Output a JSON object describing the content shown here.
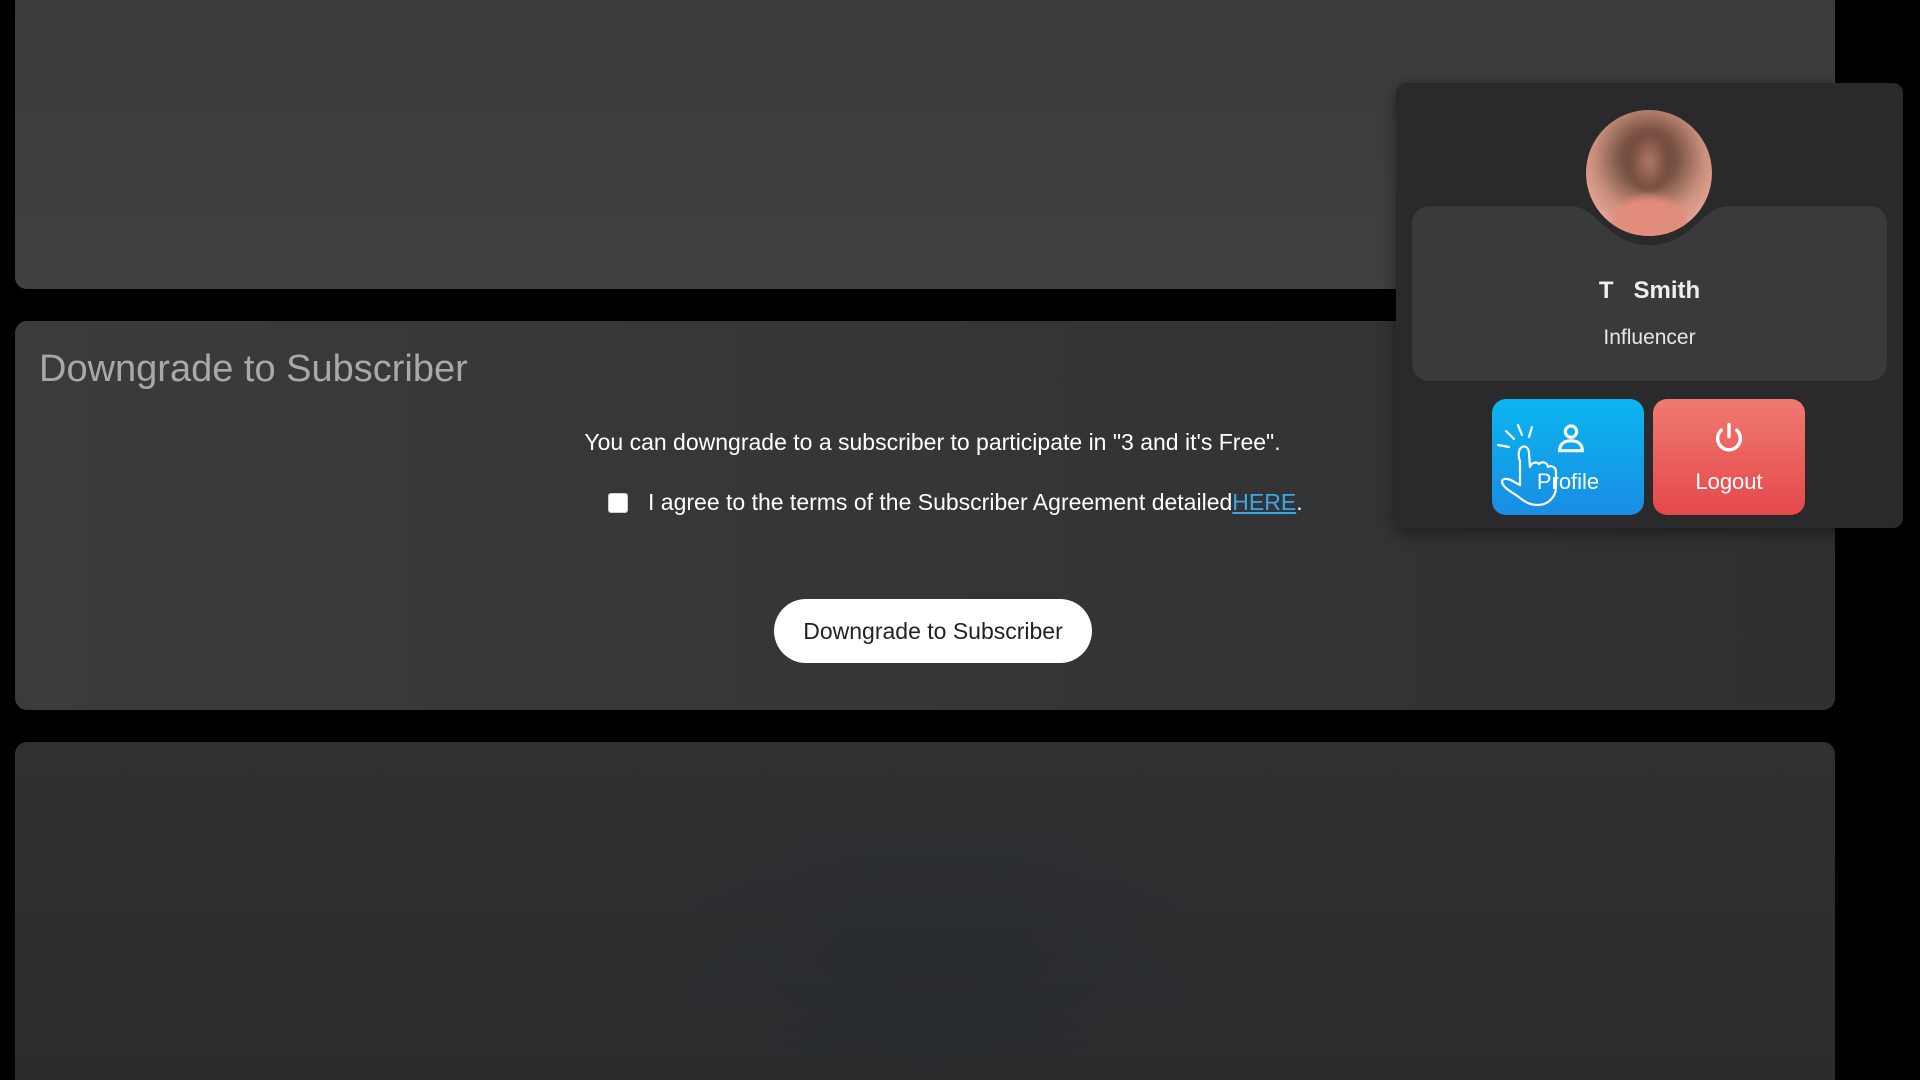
{
  "downgrade_section": {
    "title": "Downgrade to Subscriber",
    "info_text": "You can downgrade to a subscriber to participate in \"3 and it's Free\".",
    "agree_text": "I agree to the terms of the Subscriber Agreement detailed ",
    "agree_link": "HERE",
    "agree_suffix": ".",
    "agree_checked": false,
    "button_label": "Downgrade to Subscriber"
  },
  "profile_popup": {
    "first_name": "T",
    "last_name": "Smith",
    "role": "Influencer",
    "profile_button": "Profile",
    "logout_button": "Logout",
    "profile_icon": "user-icon",
    "logout_icon": "power-icon",
    "cursor_icon": "hand-click-icon",
    "profile_color": "#0ab6ef",
    "logout_color": "#e5484b"
  }
}
